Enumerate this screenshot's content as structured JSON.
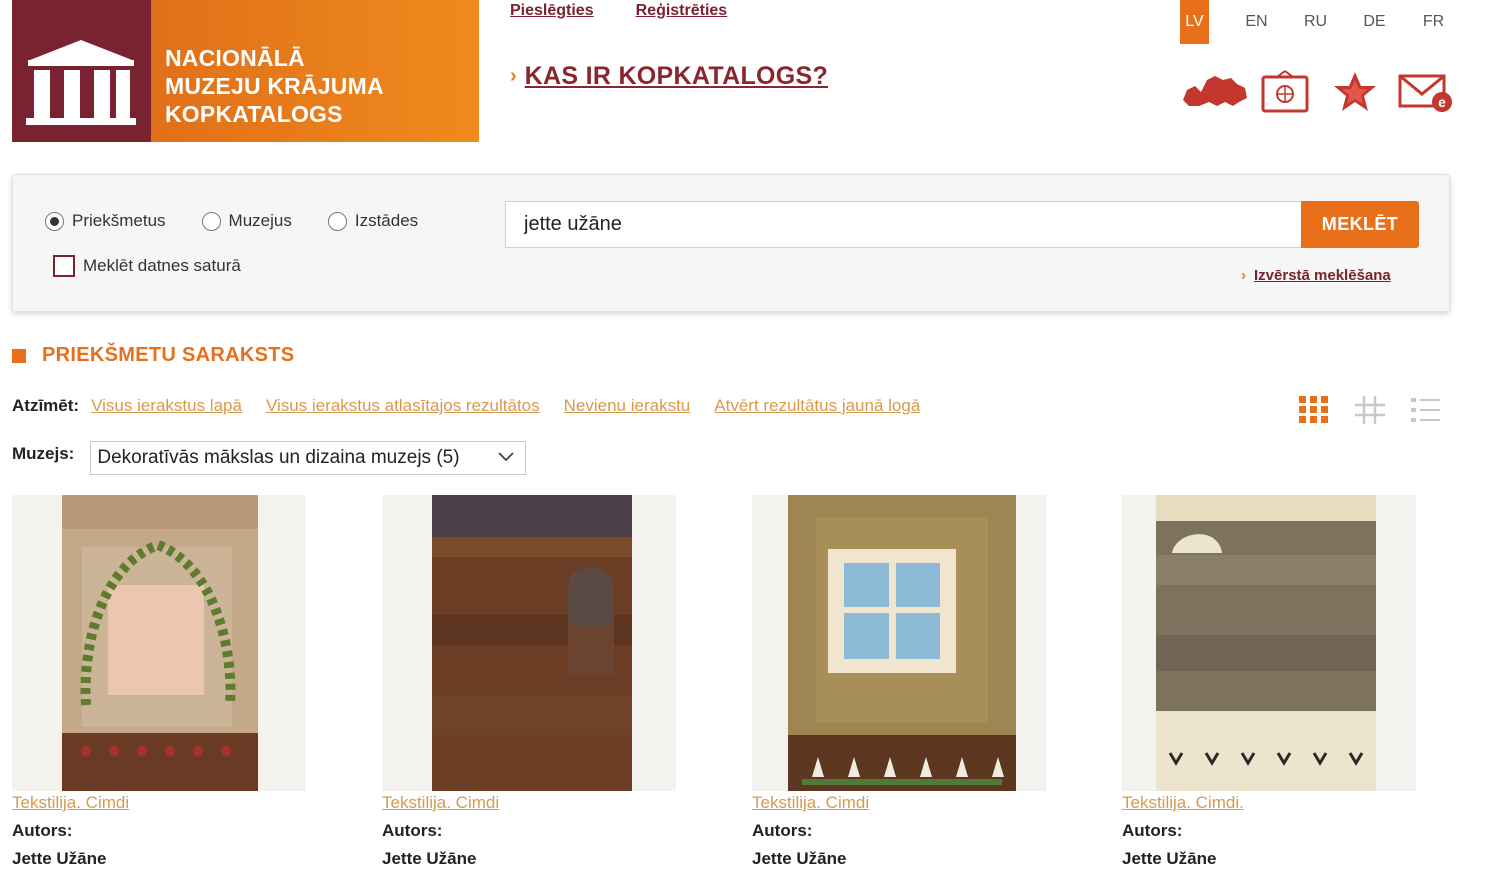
{
  "header": {
    "logo_lines": [
      "NACIONĀLĀ",
      "MUZEJU KRĀJUMA",
      "KOPKATALOGS"
    ],
    "login_label": "Pieslēgties",
    "register_label": "Reģistrēties",
    "about_link": "KAS IR KOPKATALOGS?",
    "languages": [
      "LV",
      "EN",
      "RU",
      "DE",
      "FR"
    ],
    "active_language": "LV",
    "tool_icons": [
      "latvia-map-icon",
      "exhibition-icon",
      "favorites-star-icon",
      "email-icon"
    ]
  },
  "search": {
    "types": [
      {
        "label": "Priekšmetus",
        "checked": true
      },
      {
        "label": "Muzejus",
        "checked": false
      },
      {
        "label": "Izstādes",
        "checked": false
      }
    ],
    "fulltext_label": "Meklēt datnes saturā",
    "fulltext_checked": false,
    "query": "jette užāne",
    "button_label": "MEKLĒT",
    "advanced_label": "Izvērstā meklēšana"
  },
  "results": {
    "title": "PRIEKŠMETU SARAKSTS",
    "mark_label": "Atzīmēt:",
    "mark_links": [
      "Visus ierakstus lapā",
      "Visus ierakstus atlasītajos rezultātos",
      "Nevienu ierakstu",
      "Atvērt rezultātus jaunā logā"
    ],
    "museum_label": "Muzejs:",
    "museum_selected": "Dekoratīvās mākslas un dizaina muzejs (5)",
    "view_modes": [
      "grid-large-icon",
      "grid-small-icon",
      "list-icon"
    ],
    "active_view": "grid-large-icon",
    "items": [
      {
        "category": "Tekstilija. Cimdi",
        "author_label": "Autors:",
        "author": "Jette Užāne"
      },
      {
        "category": "Tekstilija. Cimdi",
        "author_label": "Autors:",
        "author": "Jette Užāne"
      },
      {
        "category": "Tekstilija. Cimdi",
        "author_label": "Autors:",
        "author": "Jette Užāne"
      },
      {
        "category": "Tekstilija. Cimdi.",
        "author_label": "Autors:",
        "author": "Jette Užāne"
      }
    ]
  },
  "colors": {
    "brand_orange": "#e8701a",
    "brand_burgundy": "#7a2330",
    "link_tan": "#d69a4e"
  }
}
